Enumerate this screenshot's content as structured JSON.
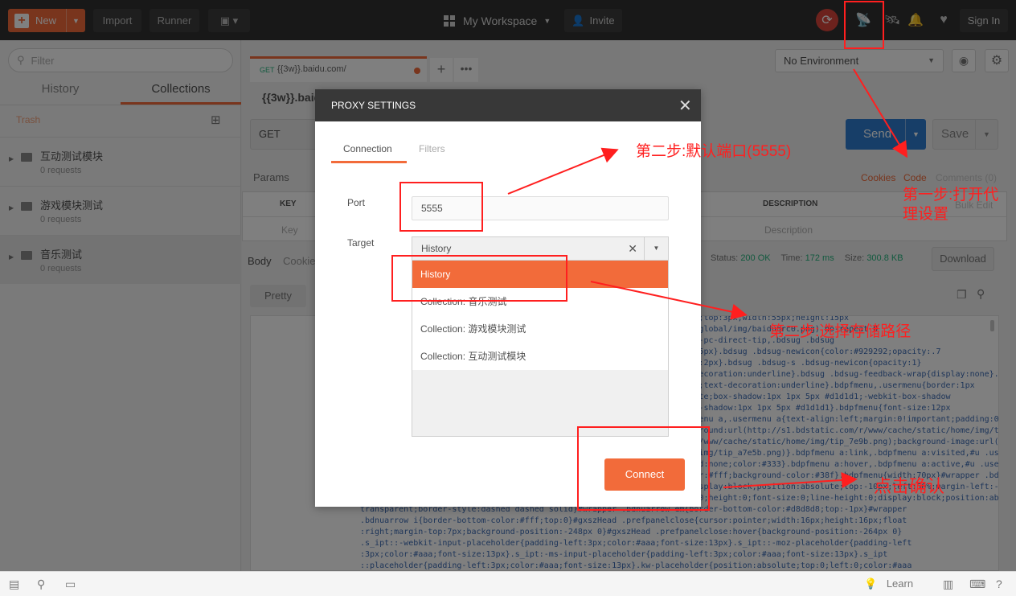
{
  "topbar": {
    "new_label": "New",
    "import_label": "Import",
    "runner_label": "Runner",
    "workspace_label": "My Workspace",
    "invite_label": "Invite",
    "signin_label": "Sign In"
  },
  "sidebar": {
    "filter_placeholder": "Filter",
    "tabs": [
      "History",
      "Collections"
    ],
    "active_tab": "Collections",
    "trash_label": "Trash",
    "collections": [
      {
        "name": "互动测试模块",
        "count": "0 requests"
      },
      {
        "name": "游戏模块测试",
        "count": "0 requests"
      },
      {
        "name": "音乐测试",
        "count": "0 requests"
      }
    ]
  },
  "request": {
    "tab_method": "GET",
    "tab_url": "{{3w}}.baidu.com/",
    "name": "{{3w}}.baid",
    "method": "GET",
    "send_label": "Send",
    "save_label": "Save",
    "params_label": "Params",
    "cookies_label": "Cookies",
    "code_label": "Code",
    "comments_label": "Comments (0)",
    "col_key": "KEY",
    "col_description": "DESCRIPTION",
    "key_placeholder": "Key",
    "description_placeholder": "Description",
    "bulk_edit_label": "Bulk Edit"
  },
  "environment": {
    "selected": "No Environment"
  },
  "response": {
    "body_tab": "Body",
    "cookies_tab": "Cookie",
    "status_label": "Status:",
    "status_value": "200 OK",
    "time_label": "Time:",
    "time_value": "172 ms",
    "size_label": "Size:",
    "size_value": "300.8 KB",
    "download_label": "Download",
    "pretty_label": "Pretty",
    "code_lines": [
      "                                         {position:absolute;right:15px;top:3px;width:55px;height:15px",
      "                                         l(//www.baidu.com/img/static/global/img/baiduqrc0.png) no-repeat 0",
      "                                         .bdsug .bdsug-direct-s .bdsug-pc-direct-tip,.bdsug .bdsug",
      "                                         z-index:1;width:15px;height:15px}.bdsug .bdsug-newicon{color:#929292;opacity:.7",
      "                                         padding-right:2px;margin-left:2px}.bdsug .bdsug-s .bdsug-newicon{opacity:1}",
      "                                         .bdsug .bdsug-feedback{text-decoration:underline}.bdsug .bdsug-feedback-wrap{display:none}.toggle",
      "                                         {display:block;cursor:pointer;text-decoration:underline}.bdpfmenu,.usermenu{border:1px",
      "                                         solid #d1d1d1;position:absolute;box-shadow:1px 1px 5px #d1d1d1;-webkit-box-shadow",
      "                                         :1px 1px 5px #d1d1d1;-moz-box-shadow:1px 1px 5px #d1d1d1}.bdpfmenu{font-size:12px",
      "                                         ;background-color:#fff}.bdpfmenu a,.usermenu a{text-align:left;margin:0!important;padding:0 9px;line",
      "                                         height:26px}.bdpfmenu a{background:url(http://s1.bdstatic.com/r/www/cache/static/home/img/tip_d7a5b.png) no-repeat;background-size:300px 18px;background-image",
      "                                         :url(http://s1.bdstatic.com/r/www/cache/static/home/img/tip_7e9b.png);background-image:url(http://s1.bdstatic",
      "                                         .com/r/www/cache/static/home/img/tip_a7e5b.png)}.bdpfmenu a:link,.bdpfmenu a:visited,#u .usermenu a:link,#u",
      "                                         .usermenu a:visited{background:none;color:#333}.bdpfmenu a:hover,.bdpfmenu a:active,#u .usermenu a:hover,#u .usermenu",
      "                                         a:active{background:none;color:#fff;background-color:#38f}.bdpfmenu{width:70px}#wrapper .bdnuarrow{width:0;height:0",
      "                                         ;font-size:0;line-height:0;display:block;position:absolute;top:-10px;left:50%;margin-left:-5px}#wrapper .bdnuarrow em",
      "                                         ,#wrapper .bdnuarrow i{width:0;height:0;font-size:0;line-height:0;display:block;position:absolute;border:5px solid",
      "transparent;border-style:dashed dashed solid}#wrapper .bdnuarrow em{border-bottom-color:#d8d8d8;top:-1px}#wrapper",
      ".bdnuarrow i{border-bottom-color:#fff;top:0}#gxszHead .prefpanelclose{cursor:pointer;width:16px;height:16px;float",
      ":right;margin-top:7px;background-position:-248px 0}#gxszHead .prefpanelclose:hover{background-position:-264px 0}",
      ".s_ipt::-webkit-input-placeholder{padding-left:3px;color:#aaa;font-size:13px}.s_ipt::-moz-placeholder{padding-left",
      ":3px;color:#aaa;font-size:13px}.s_ipt:-ms-input-placeholder{padding-left:3px;color:#aaa;font-size:13px}.s_ipt",
      "::placeholder{padding-left:3px;color:#aaa;font-size:13px}.kw-placeholder{position:absolute;top:0;left:0;color:#aaa"
    ]
  },
  "modal": {
    "title": "PROXY SETTINGS",
    "tabs": [
      "Connection",
      "Filters"
    ],
    "port_label": "Port",
    "port_value": "5555",
    "target_label": "Target",
    "target_value": "History",
    "target_options": [
      "History",
      "Collection: 音乐测试",
      "Collection: 游戏模块测试",
      "Collection: 互动测试模块"
    ],
    "connect_label": "Connect"
  },
  "bottombar": {
    "learn_label": "Learn"
  },
  "annotations": {
    "step1": "第一步:打开代理设置",
    "step2_port": "第二步:默认端口(5555)",
    "step2_path": "第二步:选择存储路径",
    "confirm": "点击确认"
  },
  "colors": {
    "accent": "#f26b3a",
    "send_blue": "#2f7dd1",
    "annotation_red": "#ff1f1f",
    "topbar": "#303030"
  }
}
